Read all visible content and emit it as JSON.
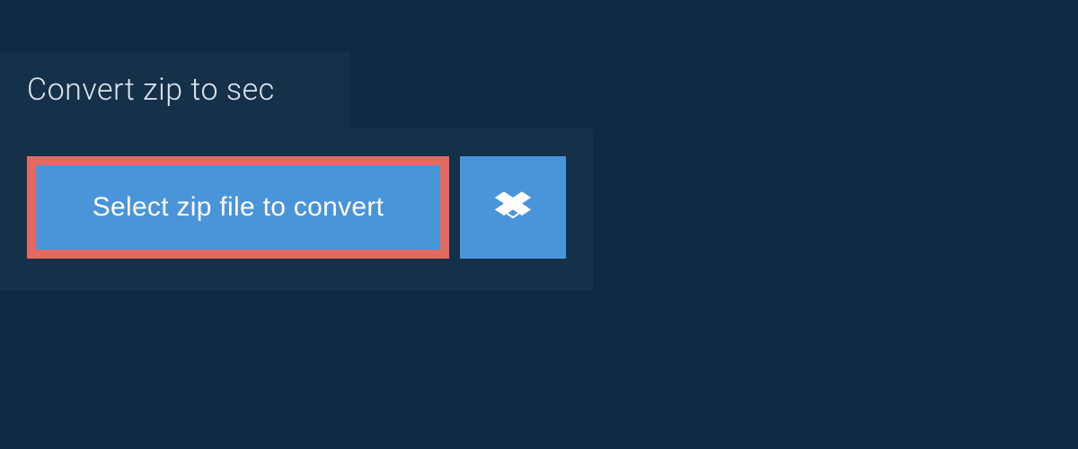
{
  "tab": {
    "title": "Convert zip to sec"
  },
  "actions": {
    "select_label": "Select zip file to convert",
    "dropbox_icon": "dropbox"
  },
  "colors": {
    "bg_outer": "#0e2a42",
    "bg_panel": "#15314a",
    "button_primary": "#4a94d9",
    "button_border_highlight": "#e46a61",
    "text_light": "#dce4ec",
    "text_on_primary": "#ffffff"
  }
}
